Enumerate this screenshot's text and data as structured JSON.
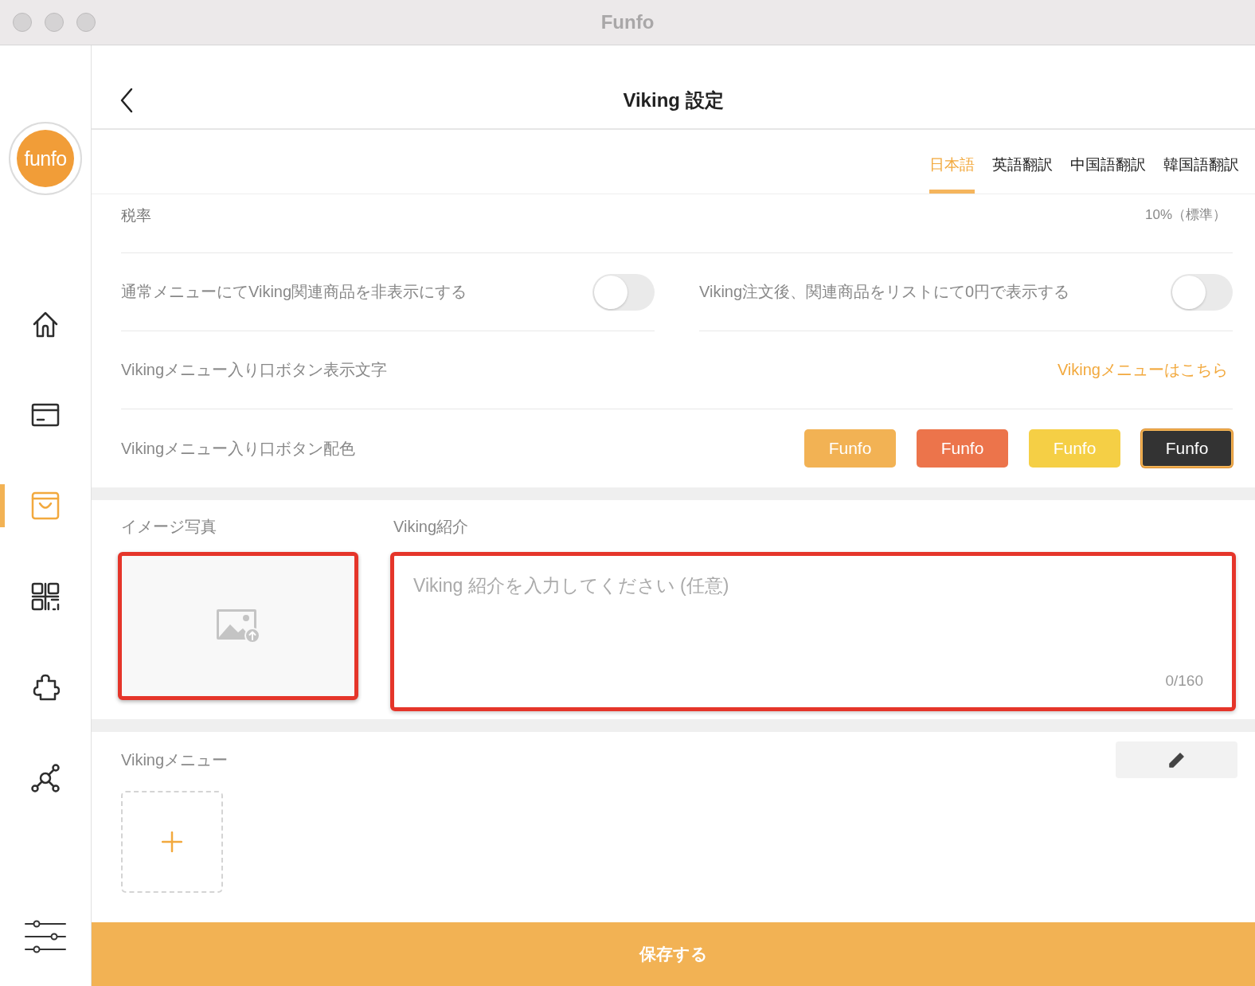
{
  "window": {
    "title": "Funfo"
  },
  "sidebar": {
    "logo": "funfo",
    "items": [
      {
        "selected": false
      },
      {
        "selected": false
      },
      {
        "selected": true
      },
      {
        "selected": false
      },
      {
        "selected": false
      },
      {
        "selected": false
      }
    ]
  },
  "header": {
    "title": "Viking 設定"
  },
  "language_tabs": [
    {
      "label": "日本語",
      "selected": true
    },
    {
      "label": "英語翻訳",
      "selected": false
    },
    {
      "label": "中国語翻訳",
      "selected": false
    },
    {
      "label": "韓国語翻訳",
      "selected": false
    }
  ],
  "tax": {
    "label": "税率",
    "value": "10%（標準）"
  },
  "toggles": [
    {
      "label": "通常メニューにてViking関連商品を非表示にする",
      "on": false
    },
    {
      "label": "Viking注文後、関連商品をリストにて0円で表示する",
      "on": false
    }
  ],
  "entry_button_text": {
    "label": "Vikingメニュー入り口ボタン表示文字",
    "value": "Vikingメニューはこちら"
  },
  "entry_button_color": {
    "label": "Vikingメニュー入り口ボタン配色",
    "options": [
      {
        "text": "Funfo",
        "color": "#f2b254",
        "selected": false
      },
      {
        "text": "Funfo",
        "color": "#ec744b",
        "selected": false
      },
      {
        "text": "Funfo",
        "color": "#f5cf45",
        "selected": false
      },
      {
        "text": "Funfo",
        "color": "#333333",
        "selected": true
      }
    ]
  },
  "image": {
    "label": "イメージ写真",
    "highlighted": true
  },
  "intro": {
    "label": "Viking紹介",
    "placeholder": "Viking 紹介を入力してください (任意)",
    "counter": "0/160",
    "highlighted": true
  },
  "viking_menu": {
    "label": "Vikingメニュー"
  },
  "save_button": "保存する"
}
